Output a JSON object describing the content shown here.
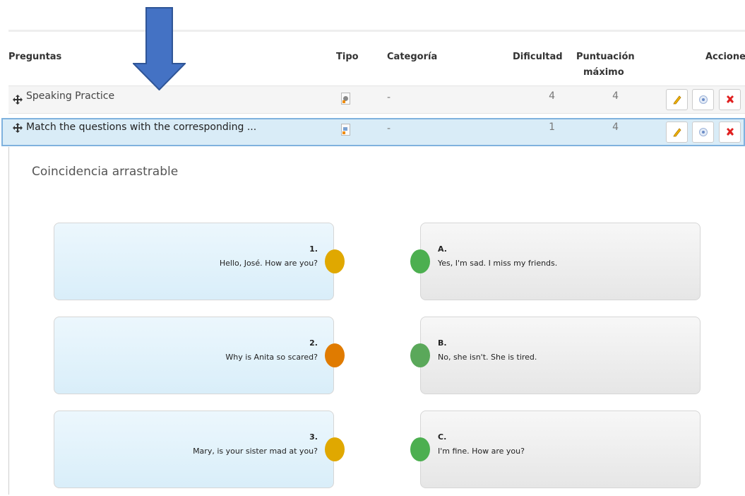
{
  "table": {
    "headers": {
      "questions": "Preguntas",
      "type": "Tipo",
      "category": "Categoría",
      "difficulty": "Dificultad",
      "max_score_line1": "Puntuación",
      "max_score_line2": "máximo",
      "actions": "Acciones"
    },
    "rows": [
      {
        "title": "Speaking Practice",
        "category": "-",
        "difficulty": "4",
        "max_score": "4"
      },
      {
        "title": "Match the questions with the corresponding ...",
        "category": "-",
        "difficulty": "1",
        "max_score": "4"
      }
    ]
  },
  "detail": {
    "type_label": "Coincidencia arrastrable",
    "questions": [
      {
        "label": "1.",
        "text": "Hello, José. How are you?",
        "knob_color": "#e0a800"
      },
      {
        "label": "2.",
        "text": "Why is Anita so scared?",
        "knob_color": "#e07b00"
      },
      {
        "label": "3.",
        "text": "Mary, is your sister mad at you?",
        "knob_color": "#e0a800"
      }
    ],
    "answers": [
      {
        "label": "A.",
        "text": "Yes, I'm sad. I miss my friends.",
        "knob_color": "#4caf50"
      },
      {
        "label": "B.",
        "text": "No, she isn't. She is tired.",
        "knob_color": "#5aa85a"
      },
      {
        "label": "C.",
        "text": "I'm fine. How are you?",
        "knob_color": "#4caf50"
      }
    ]
  },
  "colors": {
    "arrow": "#4472c4",
    "selected_row": "#d9ecf7",
    "delete": "#e02020"
  }
}
